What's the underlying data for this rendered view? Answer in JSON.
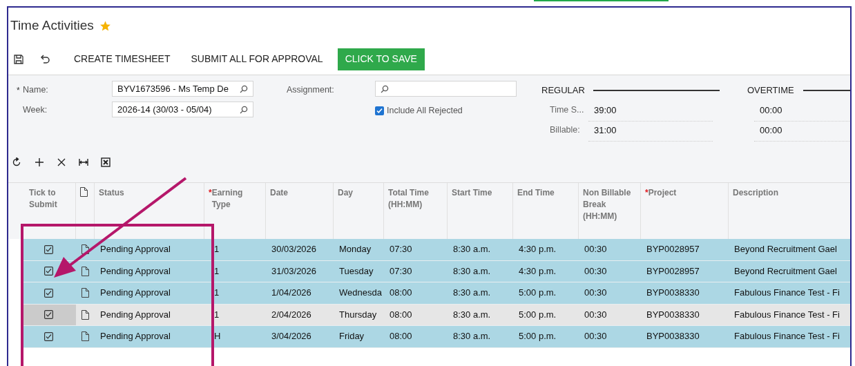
{
  "title": "Time Activities",
  "favorite": true,
  "toolbar": {
    "buttons": [
      {
        "kind": "save"
      },
      {
        "kind": "undo"
      },
      {
        "kind": "text",
        "label": "CREATE TIMESHEET"
      },
      {
        "kind": "text",
        "label": "SUBMIT ALL FOR APPROVAL"
      },
      {
        "kind": "primary",
        "label": "CLICK TO SAVE"
      }
    ]
  },
  "form": {
    "name": {
      "label": "Name:",
      "marker": "*",
      "value": "BYV1673596 - Ms Temp De"
    },
    "week": {
      "label": "Week:",
      "value": "2026-14 (30/03 - 05/04)"
    },
    "assignment": {
      "label": "Assignment:"
    },
    "include_all_rejected": {
      "label": "Include All Rejected",
      "checked": true
    },
    "summary": {
      "groups": [
        "REGULAR",
        "OVERTIME"
      ],
      "rows": [
        {
          "label": "Time S...",
          "values": [
            "39:00",
            "00:00"
          ]
        },
        {
          "label": "Billable:",
          "values": [
            "31:00",
            "00:00"
          ]
        }
      ]
    }
  },
  "grid_toolbar": [
    {
      "kind": "refresh"
    },
    {
      "kind": "add"
    },
    {
      "kind": "delete"
    },
    {
      "kind": "fit"
    },
    {
      "kind": "excel"
    }
  ],
  "table": {
    "columns": [
      {
        "label": "Tick to Submit",
        "kind": "check"
      },
      {
        "kind": "file"
      },
      {
        "label": "Status"
      },
      {
        "label": "Earning Type",
        "marker": "*"
      },
      {
        "label": "Date"
      },
      {
        "label": "Day"
      },
      {
        "label": "Total Time (HH:MM)"
      },
      {
        "label": "Start Time"
      },
      {
        "label": "End Time"
      },
      {
        "label": "Non Billable Break (HH:MM)"
      },
      {
        "label": "Project",
        "marker": "*"
      },
      {
        "label": "Description"
      }
    ],
    "rows": [
      {
        "selected": true,
        "active": false,
        "checked": true,
        "cells": [
          "",
          "",
          "Pending Approval",
          "1",
          "30/03/2026",
          "Monday",
          "07:30",
          "8:30 a.m.",
          "4:30 p.m.",
          "00:30",
          "BYP0028957",
          "Beyond Recruitment Gael"
        ]
      },
      {
        "selected": true,
        "active": false,
        "checked": true,
        "cells": [
          "",
          "",
          "Pending Approval",
          "1",
          "31/03/2026",
          "Tuesday",
          "07:30",
          "8:30 a.m.",
          "4:30 p.m.",
          "00:30",
          "BYP0028957",
          "Beyond Recruitment Gael"
        ]
      },
      {
        "selected": true,
        "active": false,
        "checked": true,
        "cells": [
          "",
          "",
          "Pending Approval",
          "1",
          "1/04/2026",
          "Wednesda",
          "08:00",
          "8:30 a.m.",
          "5:00 p.m.",
          "00:30",
          "BYP0038330",
          "Fabulous Finance Test - Fi"
        ]
      },
      {
        "selected": false,
        "active": true,
        "checked": true,
        "cells": [
          "",
          "",
          "Pending Approval",
          "1",
          "2/04/2026",
          "Thursday",
          "08:00",
          "8:30 a.m.",
          "5:00 p.m.",
          "00:30",
          "BYP0038330",
          "Fabulous Finance Test - Fi"
        ]
      },
      {
        "selected": true,
        "active": false,
        "checked": true,
        "cells": [
          "",
          "",
          "Pending Approval",
          "H",
          "3/04/2026",
          "Friday",
          "08:00",
          "8:30 a.m.",
          "5:00 p.m.",
          "00:30",
          "BYP0038330",
          "Fabulous Finance Test - Fi"
        ]
      }
    ]
  }
}
